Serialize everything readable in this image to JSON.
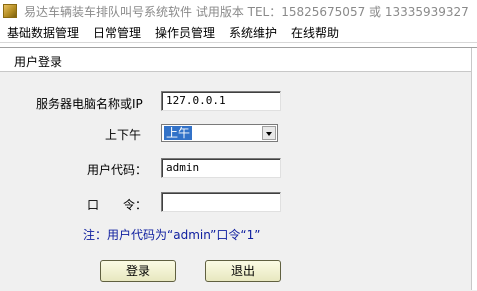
{
  "window": {
    "title": "易达车辆装车排队叫号系统软件 试用版本 TEL：15825675057 或 13335939327"
  },
  "menubar": {
    "items": [
      "基础数据管理",
      "日常管理",
      "操作员管理",
      "系统维护",
      "在线帮助"
    ]
  },
  "dialog": {
    "title": "用户登录",
    "server_label": "服务器电脑名称或IP",
    "server_value": "127.0.0.1",
    "ampm_label": "上下午",
    "ampm_value": "上午",
    "user_label": "用户代码：",
    "user_value": "admin",
    "password_label": "口　　令：",
    "password_value": "",
    "note": "注：用户代码为“admin”口令“1”",
    "login_button": "登录",
    "exit_button": "退出"
  }
}
